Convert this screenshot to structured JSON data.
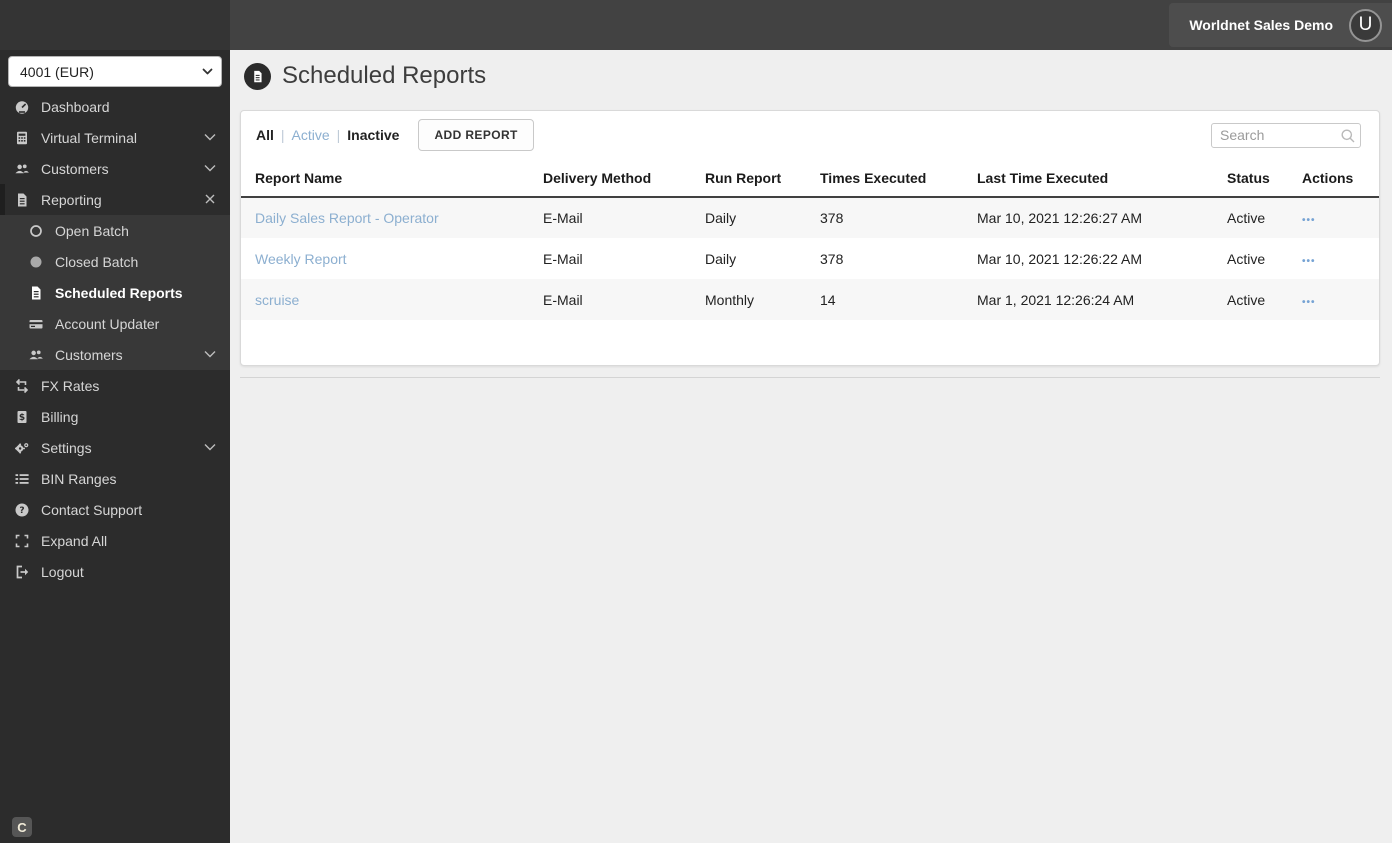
{
  "topbar": {
    "merchant_label": "Worldnet Sales Demo",
    "avatar_letter": "U"
  },
  "sidebar": {
    "account_select": {
      "value": "4001 (EUR)"
    },
    "menu": [
      {
        "label": "Dashboard",
        "icon": "dashboard-icon"
      },
      {
        "label": "Virtual Terminal",
        "icon": "virtual-terminal-icon",
        "chevron": true
      },
      {
        "label": "Customers",
        "icon": "customers-icon",
        "chevron": true
      },
      {
        "label": "Reporting",
        "icon": "reporting-icon",
        "close": true
      },
      {
        "label": "Open Batch",
        "icon": "open-batch-icon"
      },
      {
        "label": "Closed Batch",
        "icon": "closed-batch-icon"
      },
      {
        "label": "Scheduled Reports",
        "icon": "scheduled-reports-icon",
        "active": true
      },
      {
        "label": "Account Updater",
        "icon": "account-updater-icon"
      },
      {
        "label": "Customers",
        "icon": "customers-icon",
        "chevron": true
      },
      {
        "label": "FX Rates",
        "icon": "fx-rates-icon"
      },
      {
        "label": "Billing",
        "icon": "billing-icon"
      },
      {
        "label": "Settings",
        "icon": "settings-icon",
        "chevron": true
      },
      {
        "label": "BIN Ranges",
        "icon": "bin-ranges-icon"
      },
      {
        "label": "Contact Support",
        "icon": "contact-support-icon"
      },
      {
        "label": "Expand All",
        "icon": "expand-all-icon"
      },
      {
        "label": "Logout",
        "icon": "logout-icon"
      }
    ],
    "footer_logo_letter": "C"
  },
  "page": {
    "title": "Scheduled Reports",
    "filter_all": "All",
    "filter_active": "Active",
    "filter_inactive": "Inactive",
    "filter_separator": "|",
    "add_report_label": "ADD REPORT",
    "search_placeholder": "Search"
  },
  "table": {
    "columns": [
      "Report Name",
      "Delivery Method",
      "Run Report",
      "Times Executed",
      "Last Time Executed",
      "Status",
      "Actions"
    ],
    "rows": [
      {
        "name": "Daily Sales Report - Operator",
        "delivery": "E-Mail",
        "run": "Daily",
        "times": "378",
        "last": "Mar 10, 2021 12:26:27 AM",
        "status": "Active",
        "actions": "•••"
      },
      {
        "name": "Weekly Report",
        "delivery": "E-Mail",
        "run": "Daily",
        "times": "378",
        "last": "Mar 10, 2021 12:26:22 AM",
        "status": "Active",
        "actions": "•••"
      },
      {
        "name": "scruise",
        "delivery": "E-Mail",
        "run": "Monthly",
        "times": "14",
        "last": "Mar 1, 2021 12:26:24 AM",
        "status": "Active",
        "actions": "•••"
      }
    ]
  },
  "colors": {
    "sidebar_bg": "#2c2c2c",
    "submenu_bg": "#383838",
    "topbar_bg": "#424242",
    "link_accent": "#8cafd0",
    "actions_accent": "#76a3d4",
    "content_bg": "#efefef"
  }
}
